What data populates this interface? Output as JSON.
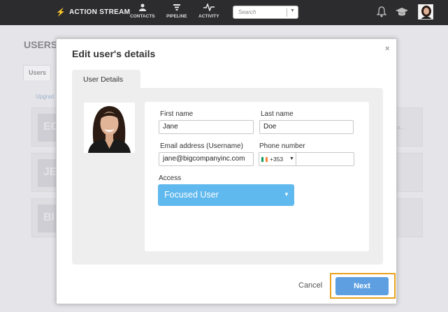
{
  "topbar": {
    "brand": "ACTION STREAM",
    "nav": [
      {
        "label": "CONTACTS",
        "icon": "person-icon"
      },
      {
        "label": "PIPELINE",
        "icon": "funnel-icon"
      },
      {
        "label": "ACTIVITY",
        "icon": "pulse-icon"
      }
    ],
    "search_placeholder": "Search",
    "icons": [
      "bell-icon",
      "graduation-cap-icon",
      "user-avatar"
    ]
  },
  "background": {
    "page_title": "USERS",
    "tab_users": "Users",
    "upgrade_link": "Upgrad",
    "cards": [
      {
        "initials": "EC"
      },
      {
        "initials": "JE"
      },
      {
        "initials": "BI"
      }
    ],
    "truncated_text": "cr..."
  },
  "modal": {
    "title": "Edit user's details",
    "close": "×",
    "tab": "User Details",
    "fields": {
      "first_name_label": "First name",
      "first_name_value": "Jane",
      "last_name_label": "Last name",
      "last_name_value": "Doe",
      "email_label": "Email address (Username)",
      "email_value": "jane@bigcompanyinc.com",
      "phone_label": "Phone number",
      "phone_code": "+353",
      "phone_value": "",
      "access_label": "Access",
      "access_value": "Focused User"
    },
    "cancel_label": "Cancel",
    "next_label": "Next"
  },
  "colors": {
    "topbar": "#2c2c2e",
    "access_select": "#5fb8ee",
    "next_button": "#5d9fe0",
    "highlight_outline": "#e8a21f"
  }
}
